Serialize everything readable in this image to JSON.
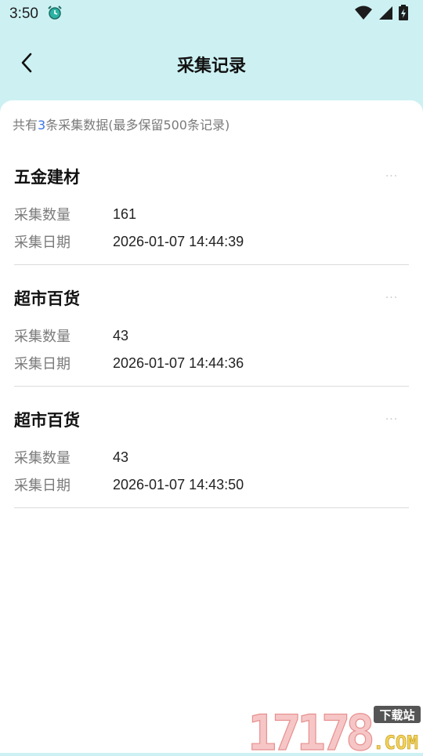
{
  "status": {
    "time": "3:50"
  },
  "nav": {
    "title": "采集记录"
  },
  "summary": {
    "prefix": "共有",
    "count": "3",
    "suffix": "条采集数据(最多保留500条记录)"
  },
  "records": [
    {
      "title": "五金建材",
      "qty_label": "采集数量",
      "qty": "161",
      "date_label": "采集日期",
      "date": "2026-01-07 14:44:39"
    },
    {
      "title": "超市百货",
      "qty_label": "采集数量",
      "qty": "43",
      "date_label": "采集日期",
      "date": "2026-01-07 14:44:36"
    },
    {
      "title": "超市百货",
      "qty_label": "采集数量",
      "qty": "43",
      "date_label": "采集日期",
      "date": "2026-01-07 14:43:50"
    }
  ],
  "more_glyph": "···",
  "watermark": {
    "digits": "17178",
    "tag": "下载站",
    "com": ".COM"
  },
  "colors": {
    "header_bg": "#cdf1f3",
    "accent": "#3a73e8"
  }
}
